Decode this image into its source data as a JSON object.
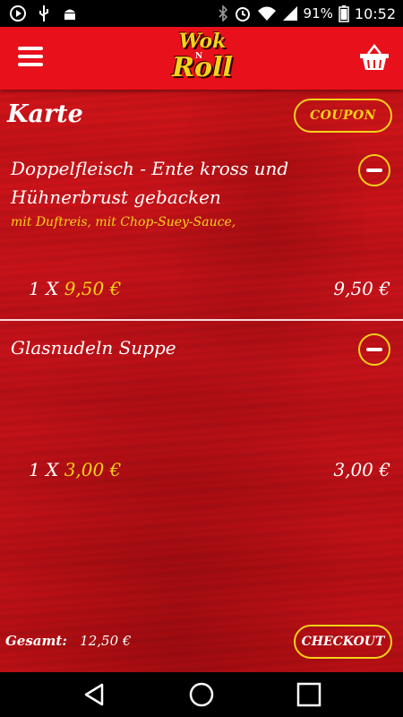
{
  "status_bar": {
    "battery": "91%",
    "time": "10:52"
  },
  "app_bar": {
    "logo_top": "Wok",
    "logo_mid": "N",
    "logo_bottom": "Roll"
  },
  "cart": {
    "title": "Karte",
    "coupon_label": "COUPON",
    "items": [
      {
        "name": "Doppelfleisch - Ente kross und Hühnerbrust gebacken",
        "description": "mit Duftreis, mit Chop-Suey-Sauce,",
        "quantity": "1 X",
        "unit_price": "9,50 €",
        "line_total": "9,50 €"
      },
      {
        "name": "Glasnudeln Suppe",
        "description": "",
        "quantity": "1 X",
        "unit_price": "3,00 €",
        "line_total": "3,00 €"
      }
    ],
    "total_label": "Gesamt:",
    "total_value": "12,50 €",
    "checkout_label": "CHECKOUT"
  },
  "colors": {
    "accent": "#f6d21a",
    "app_bar": "#e8101a",
    "background": "#c8121a"
  }
}
